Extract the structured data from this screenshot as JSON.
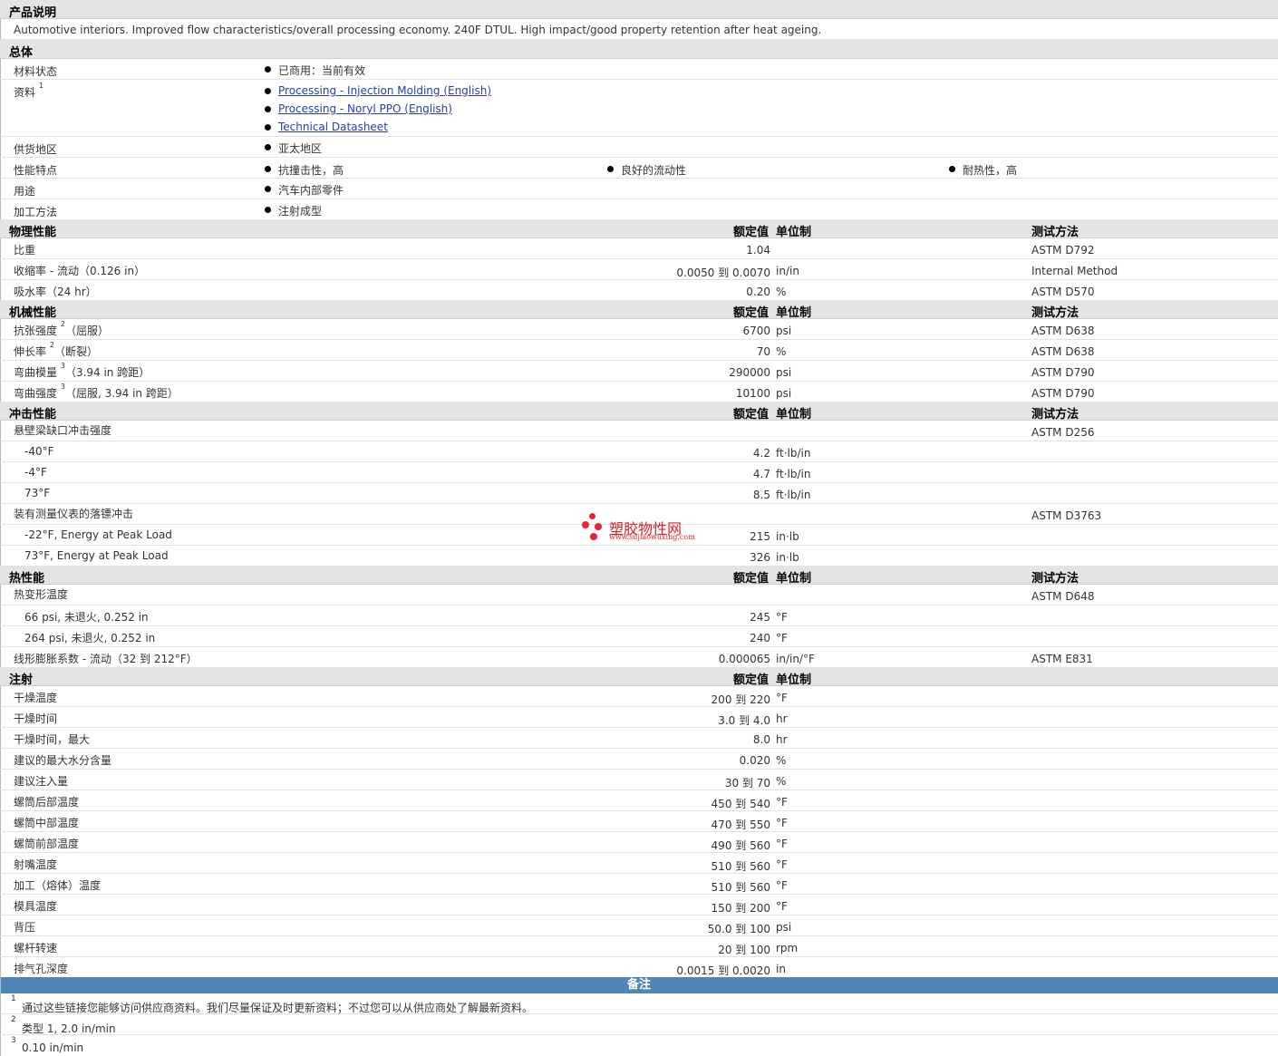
{
  "product_description": {
    "title": "产品说明",
    "text": "Automotive interiors. Improved flow characteristics/overall processing economy. 240F DTUL. High impact/good property retention after heat ageing."
  },
  "general": {
    "title": "总体",
    "material_status": {
      "label": "材料状态",
      "value": "已商用：当前有效"
    },
    "resources": {
      "label": "资料",
      "sup": "1",
      "links": [
        "Processing - Injection Molding (English)",
        "Processing - Noryl PPO (English)",
        "Technical Datasheet"
      ]
    },
    "availability": {
      "label": "供货地区",
      "value": "亚太地区"
    },
    "features": {
      "label": "性能特点",
      "values": [
        "抗撞击性，高",
        "良好的流动性",
        "耐热性，高"
      ]
    },
    "uses": {
      "label": "用途",
      "value": "汽车内部零件"
    },
    "processing": {
      "label": "加工方法",
      "value": "注射成型"
    }
  },
  "headers": {
    "value": "额定值",
    "unit": "单位制",
    "method": "测试方法"
  },
  "physical": {
    "title": "物理性能",
    "rows": [
      {
        "label": "比重",
        "value": "1.04",
        "unit": "",
        "method": "ASTM D792"
      },
      {
        "label": "收缩率 - 流动（0.126 in）",
        "value": "0.0050 到  0.0070",
        "unit": "in/in",
        "method": "Internal Method"
      },
      {
        "label": "吸水率（24 hr）",
        "value": "0.20",
        "unit": "%",
        "method": "ASTM D570"
      }
    ]
  },
  "mechanical": {
    "title": "机械性能",
    "rows": [
      {
        "label": "抗张强度",
        "sup": "2",
        "suffix": "（屈服）",
        "value": "6700",
        "unit": "psi",
        "method": "ASTM D638"
      },
      {
        "label": "伸长率",
        "sup": "2",
        "suffix": "（断裂）",
        "value": "70",
        "unit": "%",
        "method": "ASTM D638"
      },
      {
        "label": "弯曲模量",
        "sup": "3",
        "suffix": "（3.94 in 跨距）",
        "value": "290000",
        "unit": "psi",
        "method": "ASTM D790"
      },
      {
        "label": "弯曲强度",
        "sup": "3",
        "suffix": "（屈服, 3.94 in 跨距）",
        "value": "10100",
        "unit": "psi",
        "method": "ASTM D790"
      }
    ]
  },
  "impact": {
    "title": "冲击性能",
    "izod": {
      "label": "悬壁梁缺口冲击强度",
      "method": "ASTM D256"
    },
    "izod_rows": [
      {
        "label": "-40°F",
        "value": "4.2",
        "unit": "ft·lb/in"
      },
      {
        "label": "-4°F",
        "value": "4.7",
        "unit": "ft·lb/in"
      },
      {
        "label": "73°F",
        "value": "8.5",
        "unit": "ft·lb/in"
      }
    ],
    "dart": {
      "label": "装有测量仪表的落镖冲击",
      "method": "ASTM D3763"
    },
    "dart_rows": [
      {
        "label": "-22°F, Energy at Peak Load",
        "value": "215",
        "unit": "in·lb"
      },
      {
        "label": "73°F, Energy at Peak Load",
        "value": "326",
        "unit": "in·lb"
      }
    ]
  },
  "thermal": {
    "title": "热性能",
    "hdt": {
      "label": "热变形温度",
      "method": "ASTM D648"
    },
    "hdt_rows": [
      {
        "label": "66 psi, 未退火, 0.252 in",
        "value": "245",
        "unit": "°F"
      },
      {
        "label": "264 psi, 未退火, 0.252 in",
        "value": "240",
        "unit": "°F"
      }
    ],
    "clte": {
      "label": "线形膨胀系数 - 流动（32 到  212°F）",
      "value": "0.000065",
      "unit": "in/in/°F",
      "method": "ASTM E831"
    }
  },
  "injection": {
    "title": "注射",
    "rows": [
      {
        "label": "干燥温度",
        "value": "200 到  220",
        "unit": "°F"
      },
      {
        "label": "干燥时间",
        "value": "3.0 到  4.0",
        "unit": "hr"
      },
      {
        "label": "干燥时间，最大",
        "value": "8.0",
        "unit": "hr"
      },
      {
        "label": "建议的最大水分含量",
        "value": "0.020",
        "unit": "%"
      },
      {
        "label": "建议注入量",
        "value": "30 到  70",
        "unit": "%"
      },
      {
        "label": "螺筒后部温度",
        "value": "450 到  540",
        "unit": "°F"
      },
      {
        "label": "螺筒中部温度",
        "value": "470 到  550",
        "unit": "°F"
      },
      {
        "label": "螺筒前部温度",
        "value": "490 到  560",
        "unit": "°F"
      },
      {
        "label": "射嘴温度",
        "value": "510 到  560",
        "unit": "°F"
      },
      {
        "label": "加工（熔体）温度",
        "value": "510 到  560",
        "unit": "°F"
      },
      {
        "label": "模具温度",
        "value": "150 到  200",
        "unit": "°F"
      },
      {
        "label": "背压",
        "value": "50.0 到  100",
        "unit": "psi"
      },
      {
        "label": "螺杆转速",
        "value": "20 到  100",
        "unit": "rpm"
      },
      {
        "label": "排气孔深度",
        "value": "0.0015 到  0.0020",
        "unit": "in"
      }
    ]
  },
  "notes": {
    "title": "备注",
    "items": [
      {
        "n": "1",
        "text": "通过这些链接您能够访问供应商资料。我们尽量保证及时更新资料；不过您可以从供应商处了解最新资料。"
      },
      {
        "n": "2",
        "text": "类型  1, 2.0 in/min"
      },
      {
        "n": "3",
        "text": "0.10 in/min"
      }
    ]
  },
  "watermark": {
    "name": "塑胶物性网",
    "url": "www.sujiaowuxing.com",
    "color": "#d9202a"
  },
  "colors": {
    "section_bg": "#e4e4e4",
    "notes_bar": "#4f86b7",
    "link": "#2a3db0"
  }
}
